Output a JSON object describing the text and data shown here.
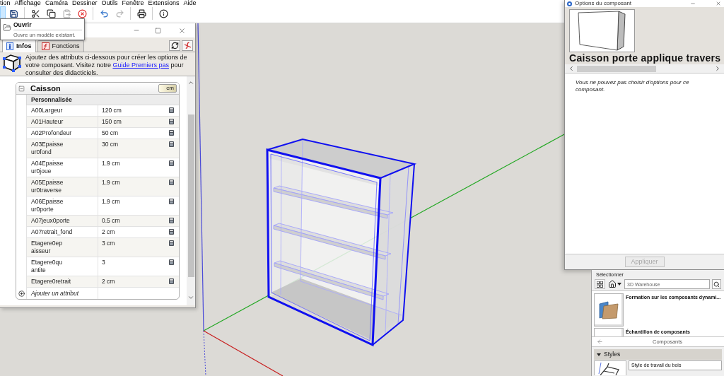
{
  "menu_bar": {
    "items": [
      "tion",
      "Affichage",
      "Caméra",
      "Dessiner",
      "Outils",
      "Fenêtre",
      "Extensions",
      "Aide"
    ]
  },
  "toolbar": {
    "groups": [
      [
        {
          "kind": "open",
          "hovered": true,
          "disabled": false
        },
        {
          "kind": "save",
          "hovered": false,
          "disabled": false
        }
      ],
      [
        {
          "kind": "cut",
          "hovered": false,
          "disabled": false
        },
        {
          "kind": "copy",
          "hovered": false,
          "disabled": false
        },
        {
          "kind": "paste",
          "hovered": false,
          "disabled": true
        },
        {
          "kind": "erase",
          "hovered": false,
          "disabled": false
        }
      ],
      [
        {
          "kind": "undo",
          "hovered": false,
          "disabled": false
        },
        {
          "kind": "redo",
          "hovered": false,
          "disabled": true
        }
      ],
      [
        {
          "kind": "print",
          "hovered": false,
          "disabled": false
        }
      ],
      [
        {
          "kind": "model_info",
          "hovered": false,
          "disabled": false
        }
      ]
    ]
  },
  "tooltip": {
    "title": "Ouvrir",
    "text": "Ouvre un modèle existant."
  },
  "attributes_window": {
    "tabs": [
      {
        "kind": "info",
        "label": "Infos",
        "selected": true
      },
      {
        "kind": "functions",
        "label": "Fonctions",
        "selected": false
      }
    ],
    "info": {
      "before": "Ajoutez des attributs ci-dessous pour créer les options de votre composant. Visitez notre",
      "link": "Guide Premiers pas",
      "after": "pour consulter des didacticiels."
    },
    "component": {
      "name": "Caisson",
      "expanded": true,
      "unit": "cm",
      "group": "Personnalisée",
      "attributes": [
        {
          "name": "A00Largeur",
          "value": "120 cm"
        },
        {
          "name": "A01Hauteur",
          "value": "150 cm"
        },
        {
          "name": "A02Profondeur",
          "value": "50 cm"
        },
        {
          "name": "A03Epaisseur0fond",
          "value": "30 cm"
        },
        {
          "name": "A04Epaisseur0joue",
          "value": "1.9 cm"
        },
        {
          "name": "A05Epaisseur0traverse",
          "value": "1.9 cm"
        },
        {
          "name": "A06Epaisseur0porte",
          "value": "1.9 cm"
        },
        {
          "name": "A07jeux0porte",
          "value": "0.5 cm"
        },
        {
          "name": "A07retrait_fond",
          "value": "2 cm"
        },
        {
          "name": "Etagere0epaisseur",
          "value": "3 cm"
        },
        {
          "name": "Etagere0quantite",
          "value": "3"
        },
        {
          "name": "Etagere0retrait",
          "value": "2 cm"
        }
      ],
      "add_label": "Ajouter un attribut"
    }
  },
  "component_options": {
    "title": "Options du composant",
    "component_name": "Caisson porte applique travers",
    "message": "Vous ne pouvez pas choisir d'options pour ce composant.",
    "apply_button": {
      "label": "Appliquer",
      "disabled": true
    }
  },
  "tray": {
    "select_label": "Sélectionner",
    "search": {
      "placeholder": "3D Warehouse"
    },
    "items": [
      {
        "title": "Formation sur les composants dynami..."
      },
      {
        "title": "Échantillon de composants"
      }
    ],
    "nav_label": "Composants",
    "styles": {
      "label": "Styles",
      "expanded": true,
      "items": [
        {
          "name": "Style de travail du bois"
        }
      ]
    }
  }
}
